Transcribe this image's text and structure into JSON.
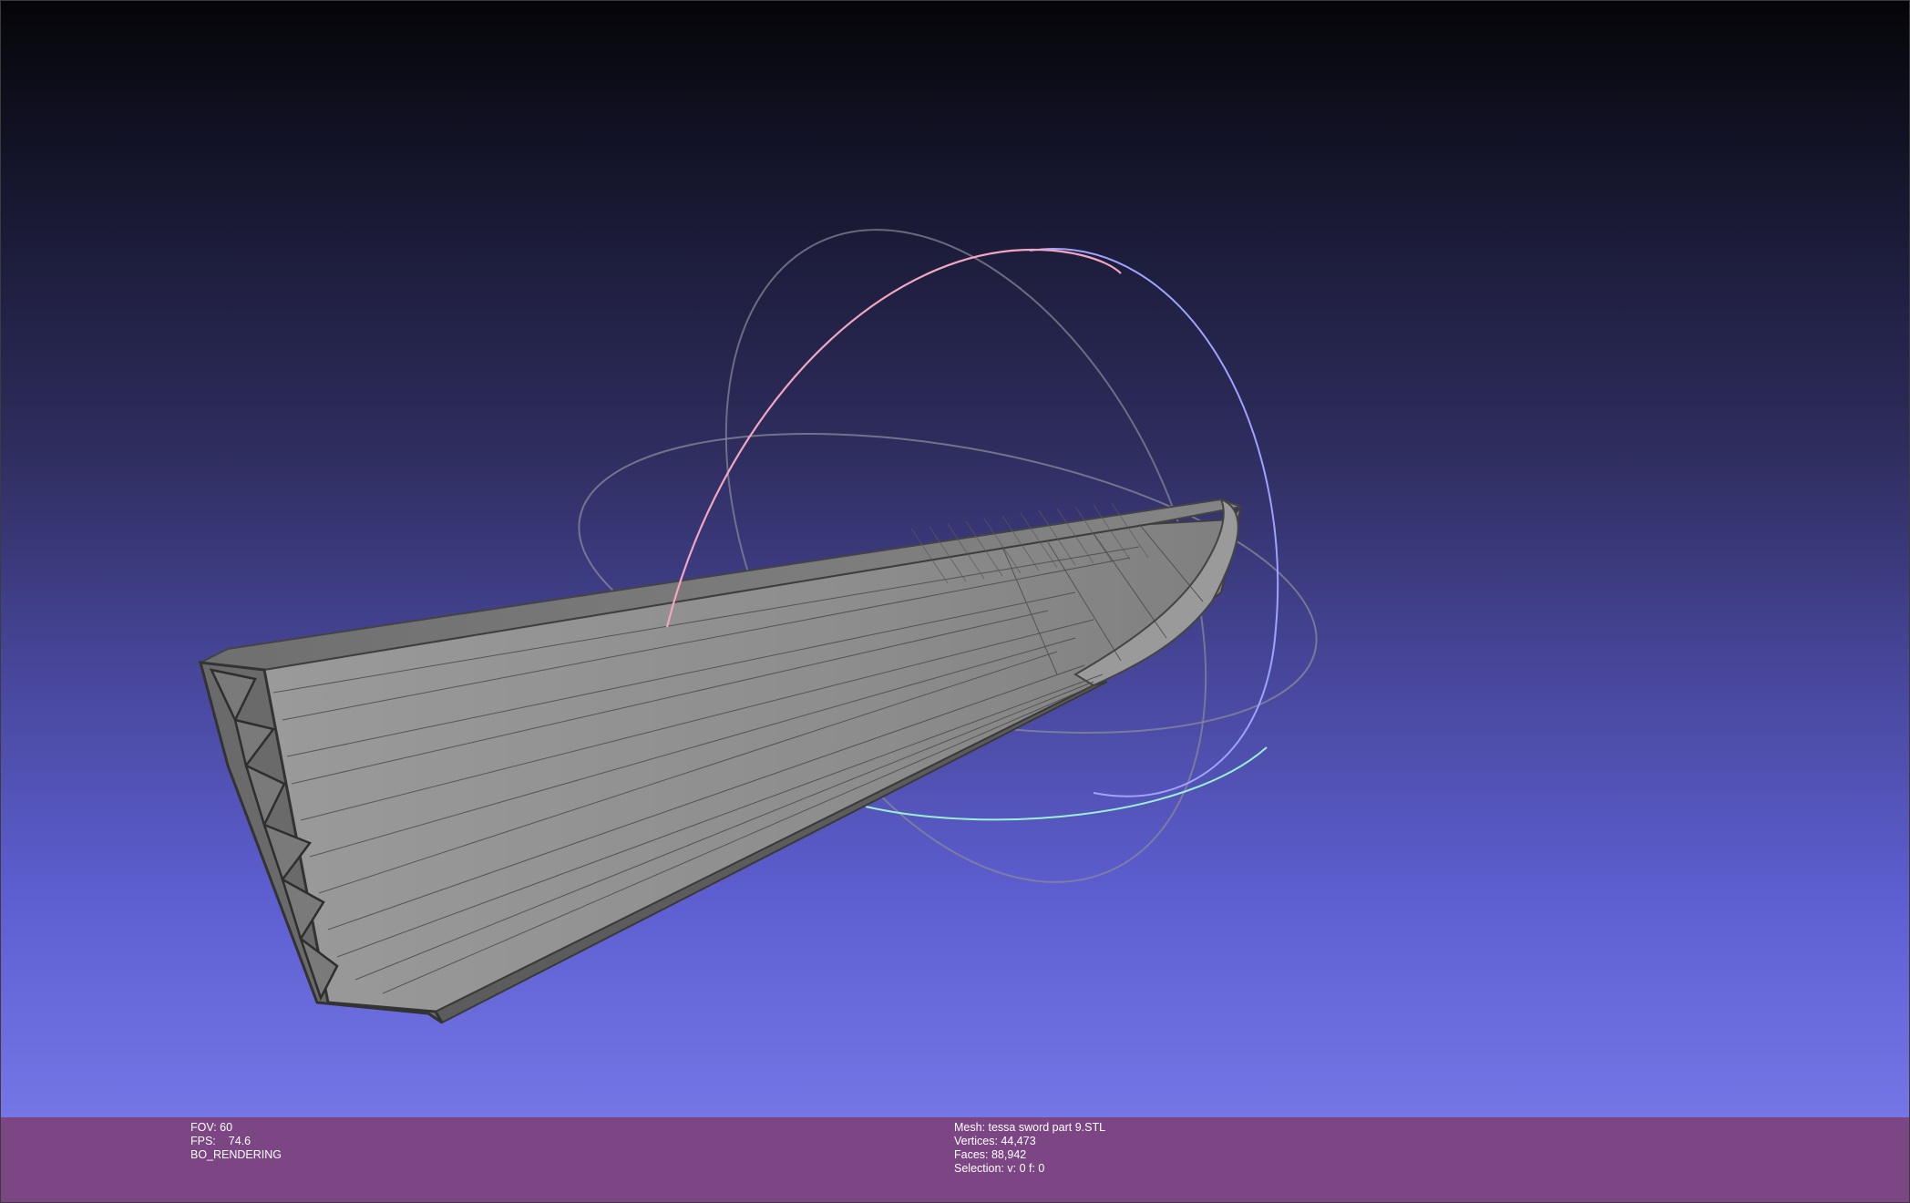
{
  "viewport": {
    "background_top": "#050508",
    "background_bottom": "#7476e6",
    "mesh_color": "#8f8f8f",
    "trackball_colors": {
      "x": "#f2a6c0",
      "y": "#9fa3ff",
      "z": "#99f0d2",
      "guide": "#8a8a9a"
    }
  },
  "status_left": {
    "fov": "FOV: 60",
    "fps_label": "FPS:",
    "fps_value": "74.6",
    "render_mode": "BO_RENDERING"
  },
  "status_right": {
    "mesh": "Mesh: tessa sword part 9.STL",
    "vertices": "Vertices: 44,473",
    "faces": "Faces: 88,942",
    "selection": "Selection: v: 0 f: 0"
  },
  "status_bar_color": "#7c4684"
}
